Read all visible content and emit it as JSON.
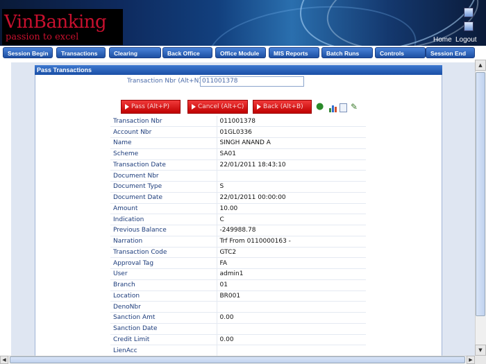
{
  "app": {
    "brand": "VinBanking",
    "tagline": "passion to excel",
    "home_label": "Home",
    "logout_label": "Logout"
  },
  "nav": {
    "items": [
      "Session Begin",
      "Transactions",
      "Clearing",
      "Back Office",
      "Office Module",
      "MIS Reports",
      "Batch Runs",
      "Controls",
      "Session End"
    ]
  },
  "panel": {
    "title": "Pass Transactions",
    "txn_label": "Transaction Nbr (Alt+N)",
    "txn_value": "011001378",
    "buttons": {
      "pass": "Pass (Alt+P)",
      "cancel": "Cancel (Alt+C)",
      "back": "Back (Alt+B)"
    },
    "icons": [
      "user-icon",
      "chart-icon",
      "document-icon",
      "edit-icon"
    ]
  },
  "details": [
    {
      "label": "Transaction Nbr",
      "value": "011001378"
    },
    {
      "label": "Account Nbr",
      "value": "01GL0336"
    },
    {
      "label": "Name",
      "value": "SINGH ANAND A"
    },
    {
      "label": "Scheme",
      "value": "SA01"
    },
    {
      "label": "Transaction Date",
      "value": "22/01/2011 18:43:10"
    },
    {
      "label": "Document Nbr",
      "value": ""
    },
    {
      "label": "Document Type",
      "value": "S"
    },
    {
      "label": "Document Date",
      "value": "22/01/2011 00:00:00"
    },
    {
      "label": "Amount",
      "value": "10.00"
    },
    {
      "label": "Indication",
      "value": "C"
    },
    {
      "label": "Previous Balance",
      "value": "-249988.78"
    },
    {
      "label": "Narration",
      "value": "Trf From 0110000163 -"
    },
    {
      "label": "Transaction Code",
      "value": "GTC2"
    },
    {
      "label": "Approval Tag",
      "value": "FA"
    },
    {
      "label": "User",
      "value": "admin1"
    },
    {
      "label": "Branch",
      "value": "01"
    },
    {
      "label": "Location",
      "value": "BR001"
    },
    {
      "label": "DenoNbr",
      "value": ""
    },
    {
      "label": "Sanction Amt",
      "value": "0.00"
    },
    {
      "label": "Sanction Date",
      "value": ""
    },
    {
      "label": "Credit Limit",
      "value": "0.00"
    },
    {
      "label": "LienAcc",
      "value": ""
    }
  ],
  "colors": {
    "header_dark": "#0a1a38",
    "brand_red": "#c8102e",
    "nav_blue": "#1d4fa3",
    "action_red": "#c00000",
    "label_blue": "#1a3a7a"
  }
}
